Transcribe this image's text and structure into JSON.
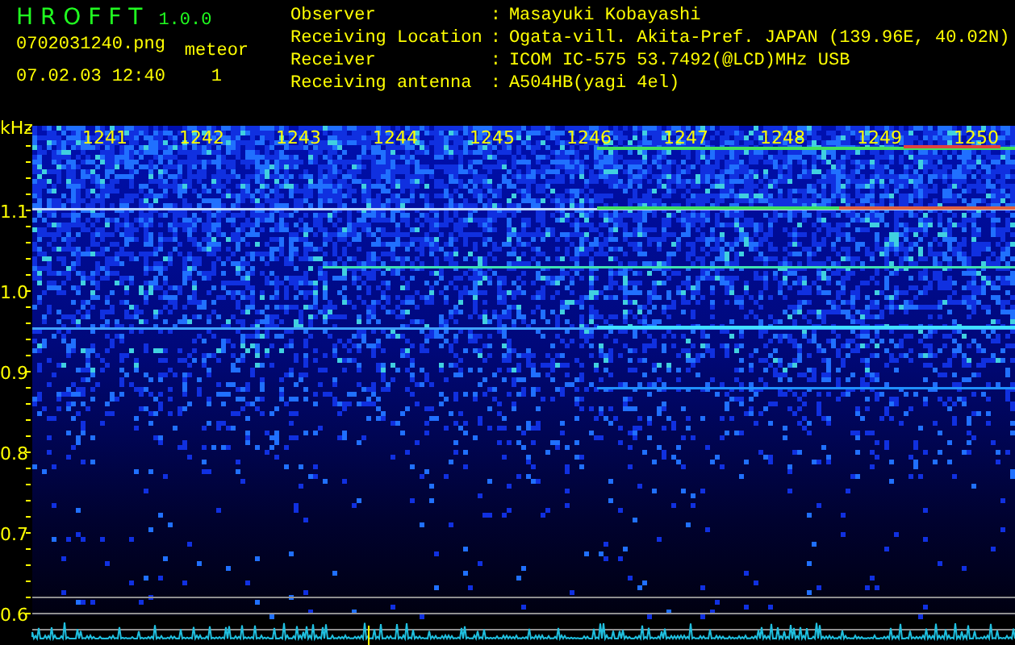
{
  "app": {
    "title": "H R O F F T",
    "version": "1.0.0"
  },
  "file": {
    "name": "0702031240.png",
    "datetime": "07.02.03 12:40"
  },
  "meteor": {
    "label": "meteor",
    "count": "1"
  },
  "info": [
    {
      "label": "Observer",
      "separator": ":",
      "value": "Masayuki Kobayashi"
    },
    {
      "label": "Receiving Location",
      "separator": ":",
      "value": "Ogata-vill. Akita-Pref. JAPAN (139.96E, 40.02N)"
    },
    {
      "label": "Receiver",
      "separator": ":",
      "value": "ICOM IC-575 53.7492(@LCD)MHz USB"
    },
    {
      "label": "Receiving antenna",
      "separator": ":",
      "value": "A504HB(yagi 4el)"
    }
  ],
  "spectrogram": {
    "unit": "kHz",
    "frequency_labels": [
      "1.1",
      "1.0",
      "0.9",
      "0.8",
      "0.7",
      "0.6"
    ],
    "time_labels": [
      "1241",
      "1242",
      "1243",
      "1244",
      "1245",
      "1246",
      "1247",
      "1248",
      "1249",
      "1250"
    ]
  }
}
